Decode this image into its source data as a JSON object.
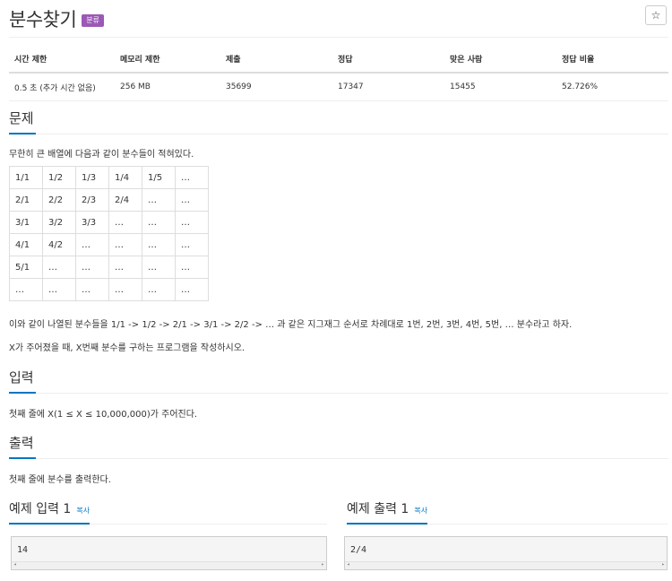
{
  "problem": {
    "title": "분수찾기",
    "badge": "분류",
    "star_icon": "☆"
  },
  "stats": {
    "headers": [
      "시간 제한",
      "메모리 제한",
      "제출",
      "정답",
      "맞은 사람",
      "정답 비율"
    ],
    "values": [
      "0.5 초 (추가 시간 없음)",
      "256 MB",
      "35699",
      "17347",
      "15455",
      "52.726%"
    ]
  },
  "sections": {
    "description_title": "문제",
    "description_intro": "무한히 큰 배열에 다음과 같이 분수들이 적혀있다.",
    "description_p2": "이와 같이 나열된 분수들을 1/1 -> 1/2 -> 2/1 -> 3/1 -> 2/2 -> … 과 같은 지그재그 순서로 차례대로 1번, 2번, 3번, 4번, 5번, … 분수라고 하자.",
    "description_p3": "X가 주어졌을 때, X번째 분수를 구하는 프로그램을 작성하시오.",
    "input_title": "입력",
    "input_text": "첫째 줄에 X(1 ≤ X ≤ 10,000,000)가 주어진다.",
    "output_title": "출력",
    "output_text": "첫째 줄에 분수를 출력한다."
  },
  "fraction_table": [
    [
      "1/1",
      "1/2",
      "1/3",
      "1/4",
      "1/5",
      "…"
    ],
    [
      "2/1",
      "2/2",
      "2/3",
      "2/4",
      "…",
      "…"
    ],
    [
      "3/1",
      "3/2",
      "3/3",
      "…",
      "…",
      "…"
    ],
    [
      "4/1",
      "4/2",
      "…",
      "…",
      "…",
      "…"
    ],
    [
      "5/1",
      "…",
      "…",
      "…",
      "…",
      "…"
    ],
    [
      "…",
      "…",
      "…",
      "…",
      "…",
      "…"
    ]
  ],
  "samples": {
    "input_title": "예제 입력 1",
    "output_title": "예제 출력 1",
    "copy_label": "복사",
    "input_value": "14",
    "output_value": "2/4",
    "scroll_left": "◂",
    "scroll_right": "▸"
  }
}
